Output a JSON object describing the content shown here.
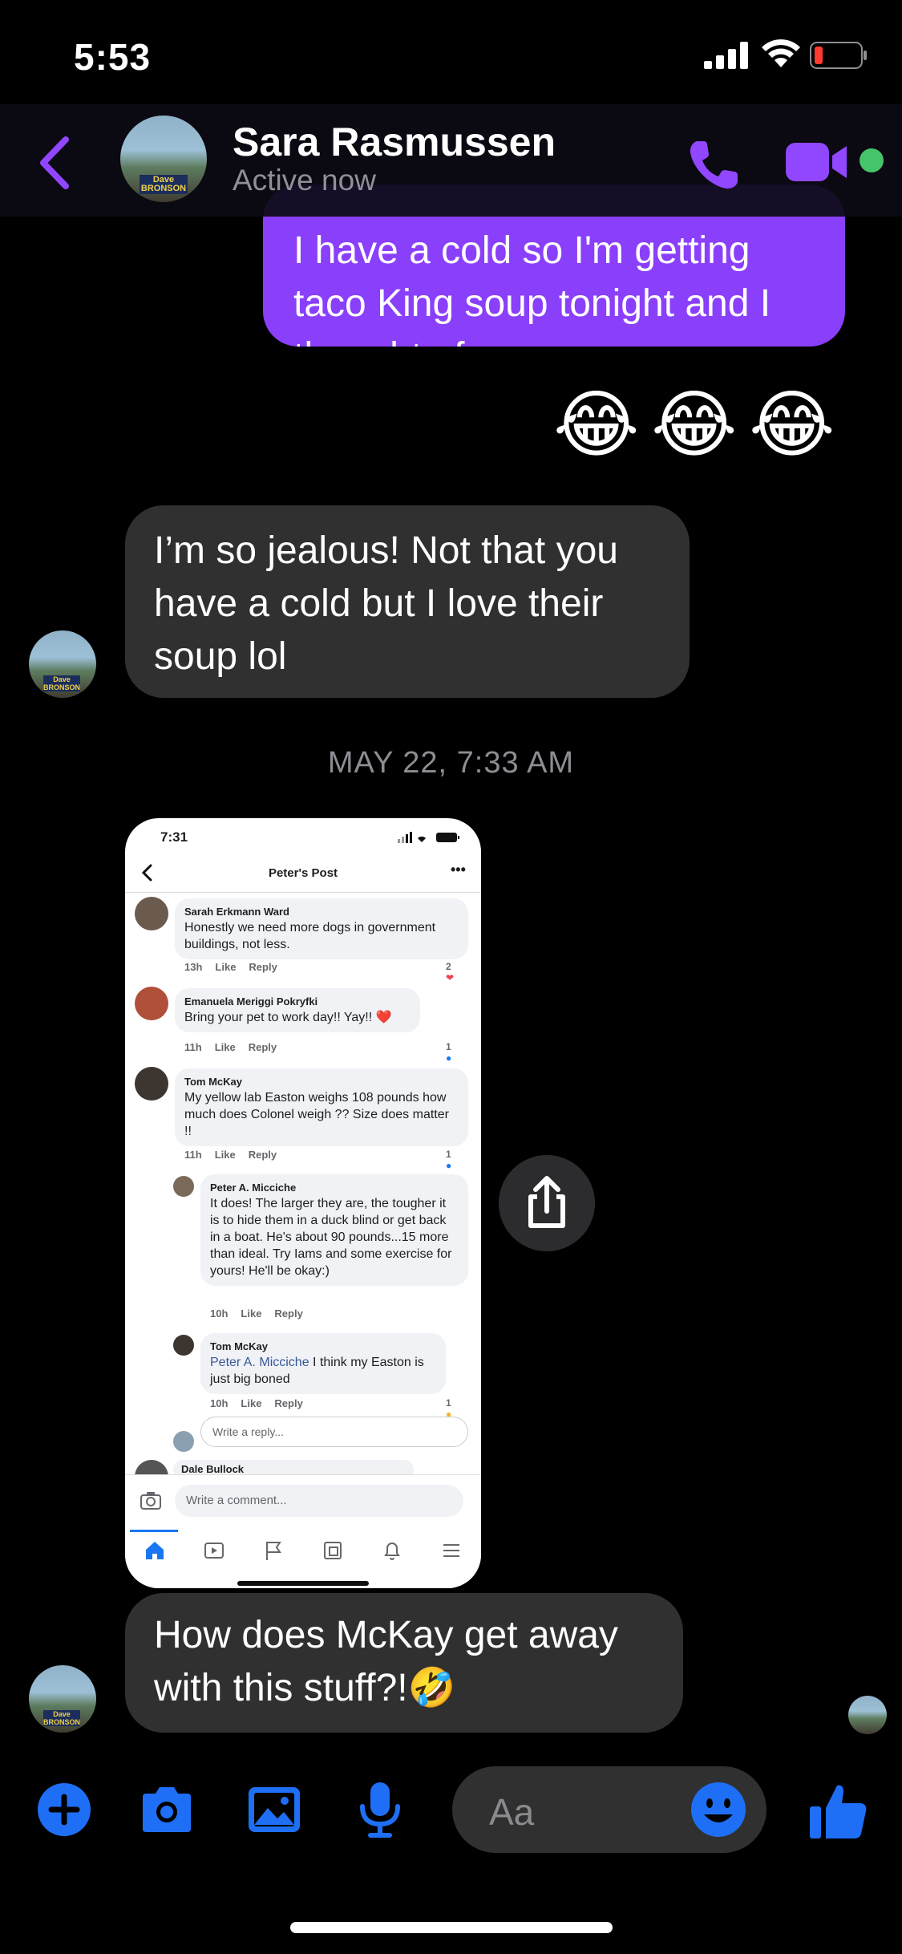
{
  "status_bar": {
    "time": "5:53"
  },
  "header": {
    "contact_name": "Sara Rasmussen",
    "status": "Active now",
    "avatar_caption": "Dave BRONSON"
  },
  "messages": {
    "outgoing_1": "I have a cold so I'm getting taco King soup tonight and I thought of you",
    "emoji_reaction": [
      "😂",
      "😂",
      "😂"
    ],
    "incoming_1": "I’m so jealous! Not that you have a cold but I love their soup lol",
    "timestamp": "MAY 22, 7:33 AM",
    "incoming_2": "How does McKay get away with this stuff?!🤣"
  },
  "shared_screenshot": {
    "time": "7:31",
    "title": "Peter's Post",
    "comments": [
      {
        "author": "Sarah Erkmann Ward",
        "text": "Honestly we need more dogs in government buildings, not less.",
        "age": "13h",
        "like": "Like",
        "reply": "Reply",
        "reactions": "2"
      },
      {
        "author": "Emanuela Meriggi Pokryfki",
        "text": "Bring your pet to work day!! Yay!! ❤️",
        "age": "11h",
        "like": "Like",
        "reply": "Reply",
        "reactions": "1"
      },
      {
        "author": "Tom McKay",
        "text": "My yellow lab Easton weighs 108 pounds how much does Colonel weigh ?? Size does matter !!",
        "age": "11h",
        "like": "Like",
        "reply": "Reply",
        "reactions": "1"
      },
      {
        "author": "Peter A. Micciche",
        "text": "It does! The larger they are, the tougher it is to hide them in a duck blind or get back in a boat. He's about 90 pounds...15 more than ideal. Try Iams and some exercise for yours! He'll be okay:)",
        "age": "10h",
        "like": "Like",
        "reply": "Reply"
      },
      {
        "author": "Tom McKay",
        "mention": "Peter A. Micciche",
        "text": " I think my Easton is just big boned",
        "age": "10h",
        "like": "Like",
        "reply": "Reply",
        "reactions": "1"
      }
    ],
    "reply_placeholder": "Write a reply...",
    "next_author": "Dale Bullock",
    "comment_placeholder": "Write a comment..."
  },
  "composer": {
    "placeholder": "Aa",
    "icons": [
      "plus-icon",
      "camera-icon",
      "photo-icon",
      "microphone-icon",
      "emoji-icon",
      "thumbs-up-icon"
    ]
  },
  "colors": {
    "outgoing_bubble": "#8a3ffb",
    "incoming_bubble": "#303030",
    "accent_purple": "#9146ff",
    "accent_blue": "#1e6ff5",
    "online": "#45c46a"
  }
}
